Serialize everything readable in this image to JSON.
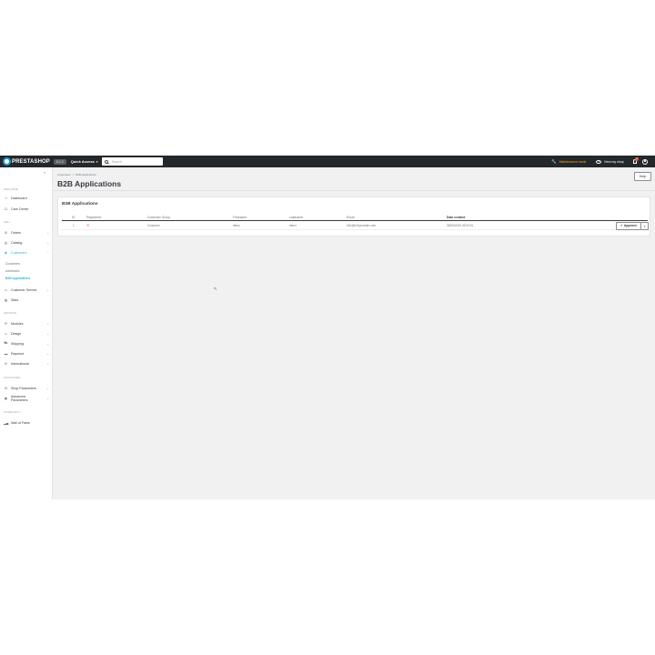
{
  "topbar": {
    "logo_text": "PRESTASHOP",
    "version": "8.1.2",
    "quick_access": "Quick Access",
    "search_placeholder": "Search",
    "maintenance": "Maintenance mode",
    "view_shop": "View my shop",
    "notifications_count": "1"
  },
  "sidebar": {
    "sections": {
      "welcome": "Welcome",
      "sell": "Sell",
      "improve": "Improve",
      "configure": "Configure",
      "more": "Community"
    },
    "items": {
      "dashboard": "Dashboard",
      "care_center": "Care Center",
      "orders": "Orders",
      "catalog": "Catalog",
      "customers": "Customers",
      "customer_service": "Customer Service",
      "stats": "Stats",
      "modules": "Modules",
      "design": "Design",
      "shipping": "Shipping",
      "payment": "Payment",
      "international": "International",
      "shop_parameters": "Shop Parameters",
      "advanced_parameters": "Advanced Parameters",
      "wall_of_fame": "Wall of Fame"
    },
    "customers_sub": [
      "Customers",
      "Addresses",
      "B2B Applications"
    ]
  },
  "breadcrumb": [
    "Customers",
    ">",
    "B2B Applications"
  ],
  "page": {
    "title": "B2B Applications",
    "help": "Help"
  },
  "card": {
    "title": "B2B Applications",
    "columns": [
      "ID",
      "Registered",
      "Customer Group",
      "Firstname",
      "Lastname",
      "Email",
      "Date created"
    ],
    "rows": [
      {
        "id": "1",
        "customer_group": "Customer",
        "firstname": "demo",
        "lastname": "demo",
        "email": "b2b@b2bprovider.com",
        "date_created": "08/25/2025 09:00:51"
      }
    ],
    "approve_label": "Approve"
  },
  "colors": {
    "topbar": "#25282b",
    "accent": "#25b9d7",
    "maintenance": "#f5a623",
    "danger": "#e2573f"
  }
}
